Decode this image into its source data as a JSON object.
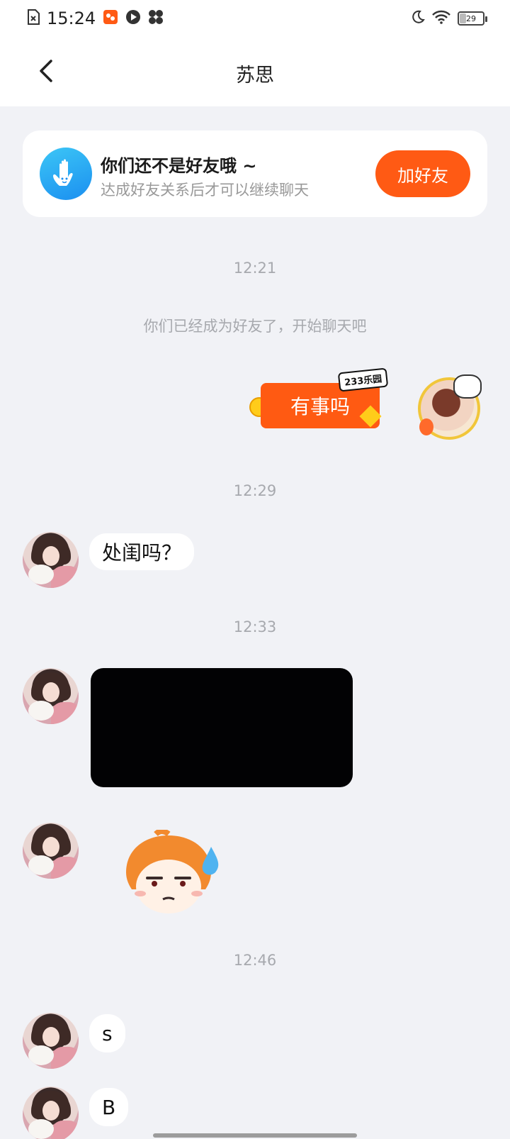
{
  "status_bar": {
    "time": "15:24",
    "battery_level": "29",
    "left_icons": [
      "sim-off-icon",
      "app-badge-icon",
      "play-icon",
      "fan-icon"
    ],
    "right_icons": [
      "moon-icon",
      "wifi-icon",
      "battery-icon"
    ]
  },
  "header": {
    "title": "苏思",
    "back_icon": "chevron-left-icon"
  },
  "friend_card": {
    "title": "你们还不是好友哦 ~",
    "subtitle": "达成好友关系后才可以继续聊天",
    "button_label": "加好友",
    "icon": "hand-wave-icon"
  },
  "messages": {
    "ts1": "12:21",
    "system": "你们已经成为好友了，开始聊天吧",
    "sticker_text": "有事吗",
    "sticker_brand": "233乐园",
    "ts2": "12:29",
    "msg1": "处闺吗？",
    "ts3": "12:33",
    "ts4": "12:46",
    "msg2": "s",
    "msg3": "B"
  },
  "colors": {
    "accent": "#ff5a14",
    "background": "#f1f2f6",
    "card": "#ffffff",
    "muted_text": "#a7a9ae"
  }
}
